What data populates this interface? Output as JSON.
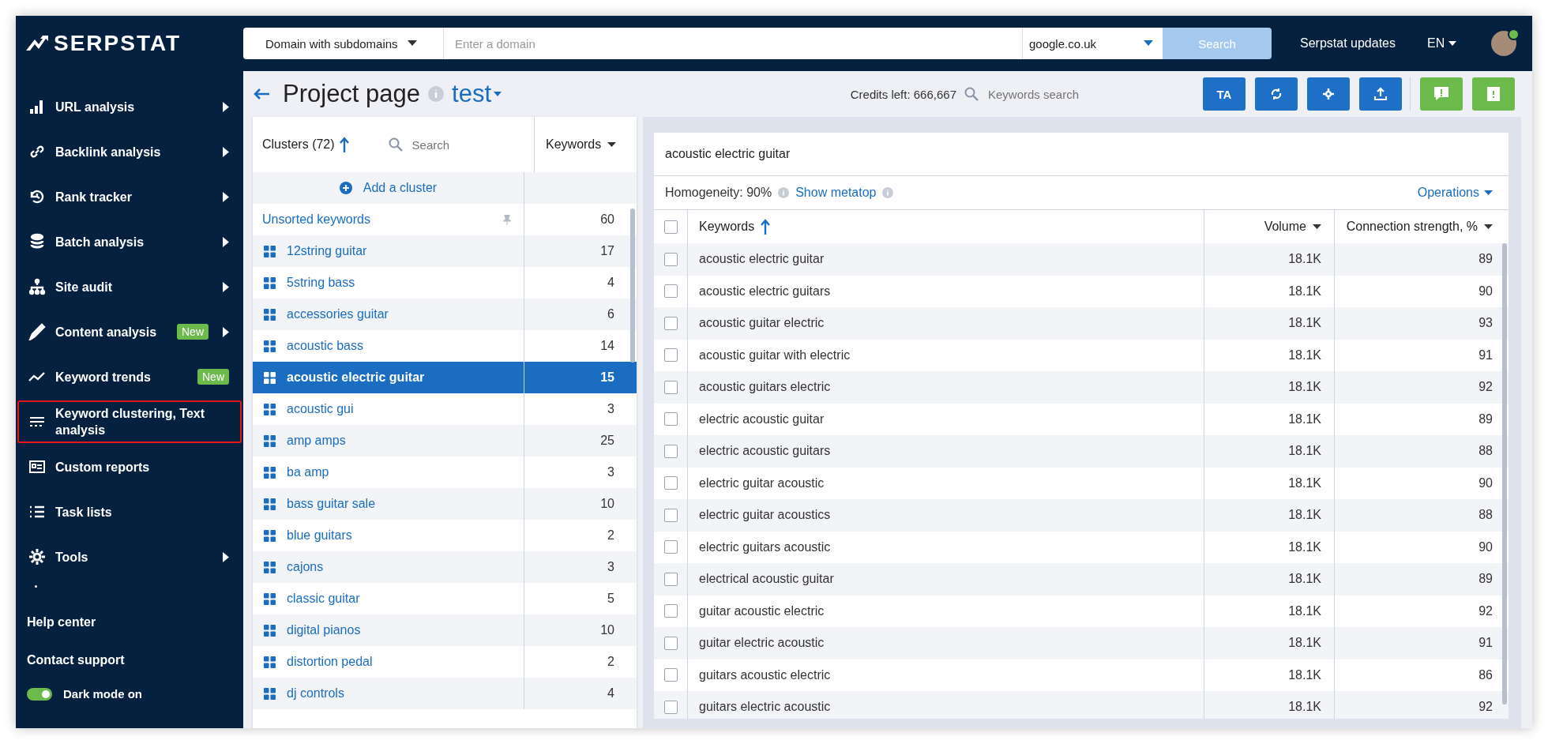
{
  "top_bar": {
    "logo": "SERPSTAT",
    "scope": "Domain with subdomains",
    "domain_placeholder": "Enter a domain",
    "engine": "google.co.uk",
    "search_button": "Search",
    "updates": "Serpstat updates",
    "language": "EN"
  },
  "sidebar": {
    "items": [
      {
        "label": "URL analysis",
        "submenu": true,
        "selected": false
      },
      {
        "label": "Backlink analysis",
        "submenu": true,
        "selected": false
      },
      {
        "label": "Rank tracker",
        "submenu": true,
        "selected": false
      },
      {
        "label": "Batch analysis",
        "submenu": true,
        "selected": false
      },
      {
        "label": "Site audit",
        "submenu": true,
        "selected": false
      },
      {
        "label": "Content analysis",
        "badge": "New",
        "submenu": true,
        "selected": false
      },
      {
        "label": "Keyword trends",
        "badge": "New",
        "submenu": false,
        "selected": false
      },
      {
        "label": "Keyword clustering, Text analysis",
        "submenu": false,
        "selected": true
      },
      {
        "label": "Custom reports",
        "submenu": false,
        "selected": false
      },
      {
        "label": "Task lists",
        "submenu": false,
        "selected": false
      },
      {
        "label": "Tools",
        "submenu": true,
        "selected": false
      }
    ],
    "links": [
      "Help center",
      "Contact support"
    ],
    "dark_mode": {
      "label": "Dark mode on",
      "on": true
    }
  },
  "header": {
    "title": "Project page",
    "project": "test",
    "credits": "Credits left: 666,667",
    "keywords_search_placeholder": "Keywords search",
    "ta_button": "TA"
  },
  "clusters": {
    "title": "Clusters (72)",
    "search_placeholder": "Search",
    "count_column": "Keywords",
    "add": "Add a cluster",
    "unsorted": {
      "label": "Unsorted keywords",
      "count": "60"
    },
    "items": [
      {
        "name": "12string guitar",
        "count": "17",
        "selected": false
      },
      {
        "name": "5string bass",
        "count": "4",
        "selected": false
      },
      {
        "name": "accessories guitar",
        "count": "6",
        "selected": false
      },
      {
        "name": "acoustic bass",
        "count": "14",
        "selected": false
      },
      {
        "name": "acoustic electric guitar",
        "count": "15",
        "selected": true
      },
      {
        "name": "acoustic gui",
        "count": "3",
        "selected": false
      },
      {
        "name": "amp amps",
        "count": "25",
        "selected": false
      },
      {
        "name": "ba amp",
        "count": "3",
        "selected": false
      },
      {
        "name": "bass guitar sale",
        "count": "10",
        "selected": false
      },
      {
        "name": "blue guitars",
        "count": "2",
        "selected": false
      },
      {
        "name": "cajons",
        "count": "3",
        "selected": false
      },
      {
        "name": "classic guitar",
        "count": "5",
        "selected": false
      },
      {
        "name": "digital pianos",
        "count": "10",
        "selected": false
      },
      {
        "name": "distortion pedal",
        "count": "2",
        "selected": false
      },
      {
        "name": "dj controls",
        "count": "4",
        "selected": false
      }
    ]
  },
  "detail": {
    "title": "acoustic electric guitar",
    "homogeneity": "Homogeneity: 90%",
    "show_metatop": "Show metatop",
    "operations": "Operations",
    "columns": [
      "Keywords",
      "Volume",
      "Connection strength, %"
    ],
    "all_checked": false,
    "rows": [
      {
        "keyword": "acoustic electric guitar",
        "volume": "18.1K",
        "strength": "89",
        "checked": false
      },
      {
        "keyword": "acoustic electric guitars",
        "volume": "18.1K",
        "strength": "90",
        "checked": false
      },
      {
        "keyword": "acoustic guitar electric",
        "volume": "18.1K",
        "strength": "93",
        "checked": false
      },
      {
        "keyword": "acoustic guitar with electric",
        "volume": "18.1K",
        "strength": "91",
        "checked": false
      },
      {
        "keyword": "acoustic guitars electric",
        "volume": "18.1K",
        "strength": "92",
        "checked": false
      },
      {
        "keyword": "electric acoustic guitar",
        "volume": "18.1K",
        "strength": "89",
        "checked": false
      },
      {
        "keyword": "electric acoustic guitars",
        "volume": "18.1K",
        "strength": "88",
        "checked": false
      },
      {
        "keyword": "electric guitar acoustic",
        "volume": "18.1K",
        "strength": "90",
        "checked": false
      },
      {
        "keyword": "electric guitar acoustics",
        "volume": "18.1K",
        "strength": "88",
        "checked": false
      },
      {
        "keyword": "electric guitars acoustic",
        "volume": "18.1K",
        "strength": "90",
        "checked": false
      },
      {
        "keyword": "electrical acoustic guitar",
        "volume": "18.1K",
        "strength": "89",
        "checked": false
      },
      {
        "keyword": "guitar acoustic electric",
        "volume": "18.1K",
        "strength": "92",
        "checked": false
      },
      {
        "keyword": "guitar electric acoustic",
        "volume": "18.1K",
        "strength": "91",
        "checked": false
      },
      {
        "keyword": "guitars acoustic electric",
        "volume": "18.1K",
        "strength": "86",
        "checked": false
      },
      {
        "keyword": "guitars electric acoustic",
        "volume": "18.1K",
        "strength": "92",
        "checked": false
      }
    ]
  }
}
